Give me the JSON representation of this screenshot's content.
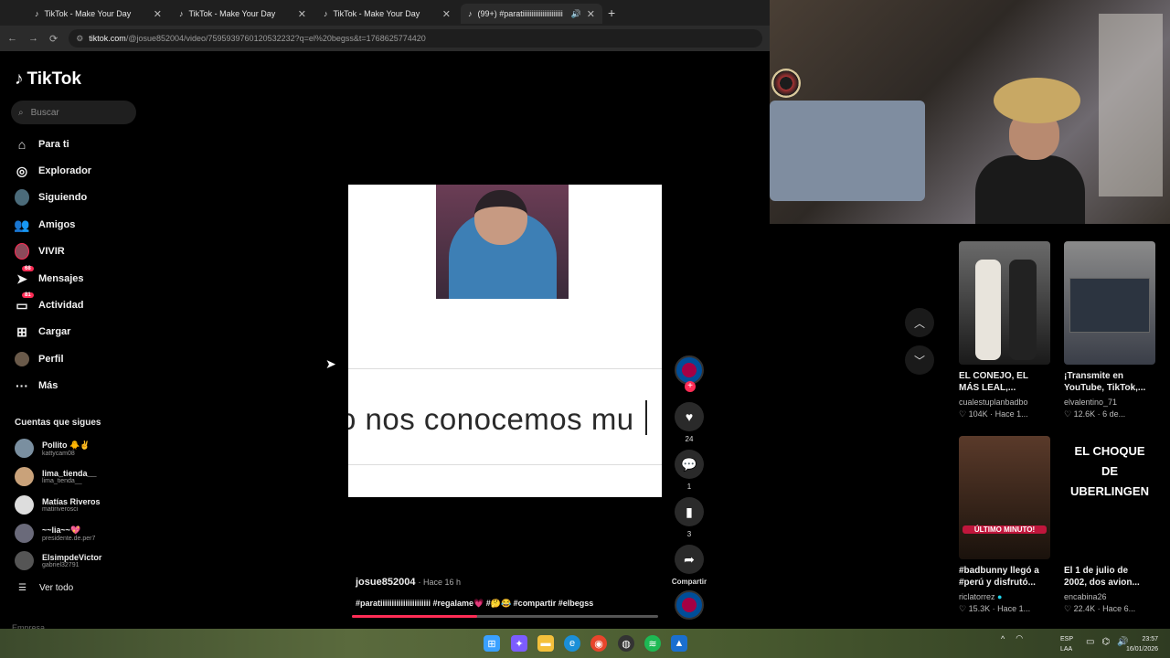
{
  "browser": {
    "tabs": [
      {
        "title": "TikTok - Make Your Day"
      },
      {
        "title": "TikTok - Make Your Day"
      },
      {
        "title": "TikTok - Make Your Day"
      },
      {
        "title": "(99+) #paratiiiiiiiiiiiiiiiiiiiiii"
      }
    ],
    "url_domain": "tiktok.com",
    "url_path": "/@josue852004/video/7595939760120532232?q=el%20begss&t=1768625774420"
  },
  "sidebar": {
    "logo": "TikTok",
    "search_placeholder": "Buscar",
    "nav": [
      {
        "label": "Para ti",
        "icon": "home-icon"
      },
      {
        "label": "Explorador",
        "icon": "compass-icon"
      },
      {
        "label": "Siguiendo",
        "icon": "following-icon"
      },
      {
        "label": "Amigos",
        "icon": "friends-icon"
      },
      {
        "label": "VIVIR",
        "icon": "live-icon"
      },
      {
        "label": "Mensajes",
        "icon": "messages-icon",
        "badge": "68"
      },
      {
        "label": "Actividad",
        "icon": "activity-icon",
        "badge": "81"
      },
      {
        "label": "Cargar",
        "icon": "upload-icon"
      },
      {
        "label": "Perfil",
        "icon": "profile-icon"
      },
      {
        "label": "Más",
        "icon": "more-icon"
      }
    ],
    "following_title": "Cuentas que sigues",
    "accounts": [
      {
        "name": "Pollito 🐥✌",
        "handle": "kattycam08"
      },
      {
        "name": "lima_tienda__",
        "handle": "lima_tienda__"
      },
      {
        "name": "Matías Riveros",
        "handle": "matiriverosci"
      },
      {
        "name": "~~lia~~💖",
        "handle": "presidente.de.per7"
      },
      {
        "name": "ElsimpdeVictor",
        "handle": "gabriel32791"
      }
    ],
    "see_all": "Ver todo",
    "footer": "Empresa"
  },
  "video": {
    "caption_overlay": "o nos conocemos mu",
    "author": "josue852004",
    "time": "· Hace 16 h",
    "description": "#paratiiiiiiiiiiiiiiiiiiiiii #regalame💗 #🤔😂 #compartir #elbegss",
    "progress": 0.41
  },
  "actions": {
    "likes": "24",
    "comments": "1",
    "saves": "3",
    "share_label": "Compartir"
  },
  "suggestions": [
    {
      "title": "EL CONEJO, EL MÁS LEAL,...",
      "user": "cualestuplanbadbo",
      "stats": "♡ 104K · Hace 1...",
      "thumb_text": ""
    },
    {
      "title": "¡Transmite en YouTube, TikTok,...",
      "user": "elvalentino_71",
      "stats": "♡ 12.6K · 6 de...",
      "thumb_text": ""
    },
    {
      "title": "#badbunny llegó a #perú y disfrutó...",
      "user": "riclatorrez",
      "stats": "♡ 15.3K · Hace 1...",
      "thumb_text": "ÚLTIMO MINUTO!"
    },
    {
      "title": "El 1 de julio de 2002, dos avion...",
      "user": "encabina26",
      "stats": "♡ 22.4K · Hace 6...",
      "thumb_text": "EL CHOQUE DE UBERLINGEN"
    }
  ],
  "taskbar": {
    "lang_top": "ESP",
    "lang_bottom": "LAA",
    "time": "23:57",
    "date": "16/01/2026"
  },
  "colors": {
    "accent": "#fe2c55",
    "background": "#000000"
  }
}
